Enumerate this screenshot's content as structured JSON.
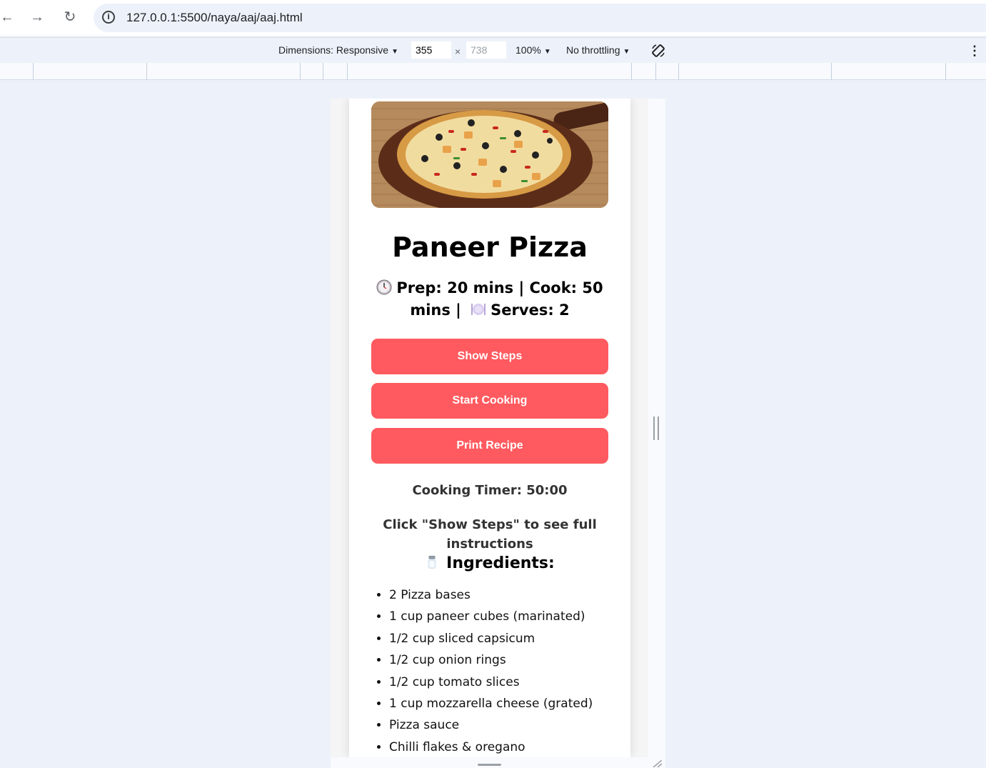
{
  "browser": {
    "url": "127.0.0.1:5500/naya/aaj/aaj.html"
  },
  "devtools": {
    "dimensions_label": "Dimensions: Responsive",
    "width": "355",
    "height_placeholder": "738",
    "times": "×",
    "zoom": "100%",
    "throttling": "No throttling"
  },
  "recipe": {
    "title": "Paneer Pizza",
    "prep_line": "Prep: 20 mins | Cook: 50 mins |",
    "serves": "Serves: 2",
    "buttons": {
      "show_steps": "Show Steps",
      "start_cooking": "Start Cooking",
      "print_recipe": "Print Recipe"
    },
    "timer": "Cooking Timer: 50:00",
    "hint": "Click \"Show Steps\" to see full instructions",
    "ingredients_heading": "Ingredients:",
    "ingredients": [
      "2 Pizza bases",
      "1 cup paneer cubes (marinated)",
      "1/2 cup sliced capsicum",
      "1/2 cup onion rings",
      "1/2 cup tomato slices",
      "1 cup mozzarella cheese (grated)",
      "Pizza sauce",
      "Chilli flakes & oregano"
    ],
    "icons": [
      "clock-icon",
      "plate-icon",
      "salt-shaker-icon",
      "pizza-image"
    ]
  },
  "colors": {
    "accent": "#ff5a5f",
    "page_bg": "#edf2fa"
  }
}
